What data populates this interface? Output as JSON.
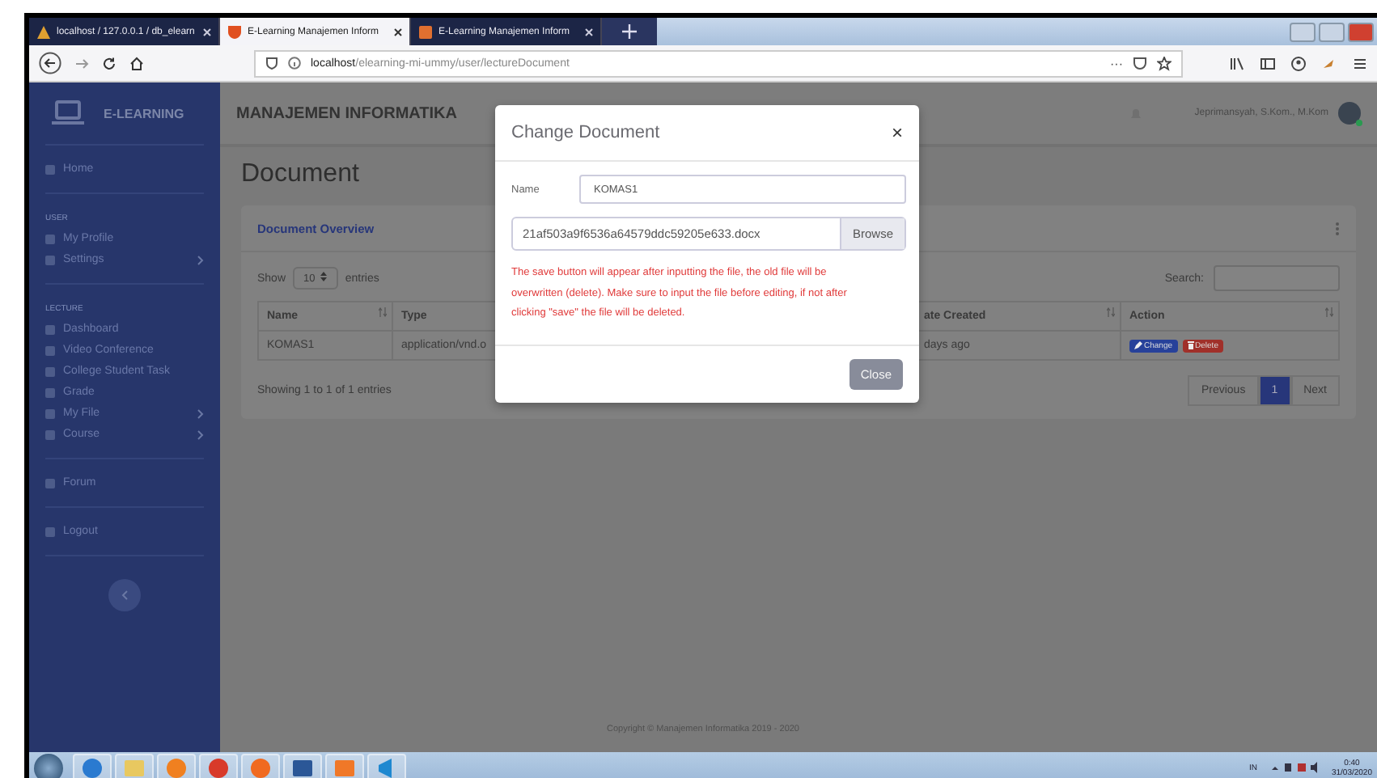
{
  "browser": {
    "tabs": [
      {
        "title": "localhost / 127.0.0.1 / db_elearn",
        "selected": false,
        "kind": "db"
      },
      {
        "title": "E-Learning Manajemen Inform",
        "selected": true,
        "kind": "shield"
      },
      {
        "title": "E-Learning Manajemen Inform",
        "selected": false,
        "kind": "box"
      }
    ],
    "url": {
      "host": "localhost",
      "path": "/elearning-mi-ummy/user/lectureDocument"
    },
    "more": "···"
  },
  "app": {
    "brand": "E-LEARNING",
    "header_title": "MANAJEMEN INFORMATIKA",
    "user": "Jeprimansyah, S.Kom., M.Kom"
  },
  "sidebar": {
    "sections": [
      {
        "items": [
          {
            "label": "Home",
            "submenu": false
          }
        ]
      },
      {
        "heading": "USER",
        "items": [
          {
            "label": "My Profile",
            "submenu": false
          },
          {
            "label": "Settings",
            "submenu": true
          }
        ]
      },
      {
        "heading": "LECTURE",
        "items": [
          {
            "label": "Dashboard",
            "submenu": false
          },
          {
            "label": "Video Conference",
            "submenu": false
          },
          {
            "label": "College Student Task",
            "submenu": false
          },
          {
            "label": "Grade",
            "submenu": false
          },
          {
            "label": "My File",
            "submenu": true
          },
          {
            "label": "Course",
            "submenu": true
          }
        ]
      },
      {
        "items": [
          {
            "label": "Forum",
            "submenu": false
          }
        ]
      },
      {
        "items": [
          {
            "label": "Logout",
            "submenu": false
          }
        ]
      }
    ]
  },
  "page_title": "Document",
  "card": {
    "title": "Document Overview",
    "show_label": "Show",
    "page_size": "10",
    "entries_label": "entries",
    "search_label": "Search:",
    "columns": [
      {
        "label": "Name",
        "sortable": true
      },
      {
        "label": "Type"
      },
      {
        "label": "ate Created",
        "sortable": true
      },
      {
        "label": "Action",
        "sortable": true
      }
    ],
    "rows": [
      {
        "cells": [
          "KOMAS1",
          "application/vnd.o",
          "days ago"
        ],
        "actions": [
          {
            "label": "Change",
            "kind": "edit"
          },
          {
            "label": "Delete",
            "kind": "delete"
          }
        ]
      }
    ],
    "info": "Showing 1 to 1 of 1 entries",
    "pagination": [
      {
        "label": "Previous",
        "selected": false
      },
      {
        "label": "1",
        "selected": true
      },
      {
        "label": "Next",
        "selected": false
      }
    ]
  },
  "footer": "Copyright © Manajemen Informatika 2019 - 2020",
  "modal": {
    "title": "Change Document",
    "close_glyph": "×",
    "name_label": "Name",
    "name_value": "KOMAS1",
    "file_name": "21af503a9f6536a64579ddc59205e633.docx",
    "browse": "Browse",
    "warning": "The save button will appear after inputting the file, the old file will be overwritten (delete). Make sure to input the file before editing, if not after clicking \"save\" the file will be deleted.",
    "close_button": "Close"
  },
  "taskbar": {
    "apps": [
      {
        "kind": "ie"
      },
      {
        "kind": "folder"
      },
      {
        "kind": "media"
      },
      {
        "kind": "chrome"
      },
      {
        "kind": "firefox"
      },
      {
        "kind": "word"
      },
      {
        "kind": "xampp"
      },
      {
        "kind": "vscode"
      }
    ],
    "language": "IN",
    "time": "0:40",
    "date": "31/03/2020"
  }
}
